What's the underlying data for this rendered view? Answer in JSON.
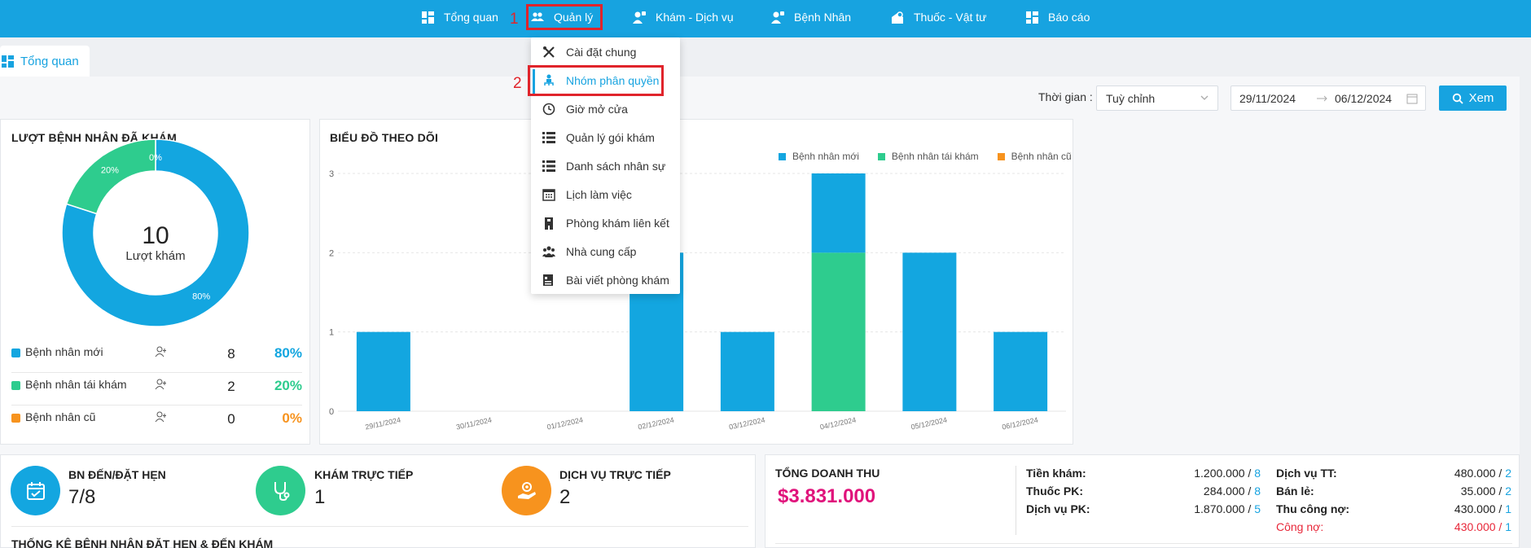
{
  "nav": {
    "items": [
      {
        "label": "Tổng quan",
        "icon": "dashboard-icon"
      },
      {
        "label": "Quản lý",
        "icon": "users-icon"
      },
      {
        "label": "Khám - Dịch vụ",
        "icon": "user-doctor-icon"
      },
      {
        "label": "Bệnh Nhân",
        "icon": "user-patient-icon"
      },
      {
        "label": "Thuốc - Vật tư",
        "icon": "pill-icon"
      },
      {
        "label": "Báo cáo",
        "icon": "report-icon"
      }
    ],
    "step1": "1",
    "step2": "2"
  },
  "tab": {
    "label": "Tổng quan"
  },
  "filter": {
    "label": "Thời gian :",
    "range_option": "Tuỳ chỉnh",
    "date_from": "29/11/2024",
    "date_to": "06/12/2024",
    "view_button": "Xem"
  },
  "menu": {
    "items": [
      {
        "label": "Cài đặt chung",
        "icon": "tools-icon"
      },
      {
        "label": "Nhóm phân quyền",
        "icon": "org-icon"
      },
      {
        "label": "Giờ mở cửa",
        "icon": "clock-icon"
      },
      {
        "label": "Quản lý gói khám",
        "icon": "list-icon"
      },
      {
        "label": "Danh sách nhân sự",
        "icon": "list-icon"
      },
      {
        "label": "Lịch làm việc",
        "icon": "calendar-icon"
      },
      {
        "label": "Phòng khám liên kết",
        "icon": "building-icon"
      },
      {
        "label": "Nhà cung cấp",
        "icon": "people-icon"
      },
      {
        "label": "Bài viết phòng khám",
        "icon": "document-icon"
      }
    ]
  },
  "patients_card": {
    "title": "LƯỢT BỆNH NHÂN ĐÃ KHÁM",
    "total": "10",
    "total_label": "Lượt khám",
    "rows": [
      {
        "name": "Bệnh nhân mới",
        "count": "8",
        "percent": "80%",
        "color": "#13a6e0"
      },
      {
        "name": "Bệnh nhân tái khám",
        "count": "2",
        "percent": "20%",
        "color": "#2ecc8e"
      },
      {
        "name": "Bệnh nhân cũ",
        "count": "0",
        "percent": "0%",
        "color": "#f7931e"
      }
    ]
  },
  "chart_data": [
    {
      "type": "pie",
      "labels": [
        "Bệnh nhân mới",
        "Bệnh nhân tái khám",
        "Bệnh nhân cũ"
      ],
      "values": [
        8,
        2,
        0
      ],
      "slice_labels": [
        "80%",
        "20%",
        "0%"
      ],
      "colors": [
        "#13a6e0",
        "#2ecc8e",
        "#f7931e"
      ]
    },
    {
      "type": "bar",
      "title": "BIỂU ĐỒ THEO DÕI",
      "stacked": true,
      "categories": [
        "29/11/2024",
        "30/11/2024",
        "01/12/2024",
        "02/12/2024",
        "03/12/2024",
        "04/12/2024",
        "05/12/2024",
        "06/12/2024"
      ],
      "series": [
        {
          "name": "Bệnh nhân cũ",
          "values": [
            0,
            0,
            0,
            0,
            0,
            0,
            0,
            0
          ],
          "color": "#f7931e"
        },
        {
          "name": "Bệnh nhân tái khám",
          "values": [
            0,
            0,
            0,
            0,
            0,
            2,
            0,
            0
          ],
          "color": "#2ecc8e"
        },
        {
          "name": "Bệnh nhân mới",
          "values": [
            1,
            0,
            0,
            2,
            1,
            1,
            2,
            1
          ],
          "color": "#13a6e0"
        }
      ],
      "legend_order": [
        "Bệnh nhân mới",
        "Bệnh nhân tái khám",
        "Bệnh nhân cũ"
      ],
      "yticks": [
        "0",
        "1",
        "2",
        "3"
      ],
      "ylim": [
        0,
        3
      ],
      "legend_position": "top-right",
      "grid": true
    }
  ],
  "stats": {
    "appointments": {
      "label": "BN ĐẾN/ĐẶT HẸN",
      "value": "7/8",
      "color": "#13a6e0"
    },
    "direct_exam": {
      "label": "KHÁM TRỰC TIẾP",
      "value": "1",
      "color": "#2ecc8e"
    },
    "direct_service": {
      "label": "DỊCH VỤ TRỰC TIẾP",
      "value": "2",
      "color": "#f7931e"
    },
    "section_title": "THỐNG KÊ BỆNH NHÂN ĐẶT HẸN & ĐẾN KHÁM"
  },
  "revenue": {
    "title": "TỔNG DOANH THU",
    "total": "$3.831.000",
    "left": [
      {
        "label": "Tiền khám:",
        "amount": "1.200.000",
        "count": "8"
      },
      {
        "label": "Thuốc PK:",
        "amount": "284.000",
        "count": "8"
      },
      {
        "label": "Dịch vụ PK:",
        "amount": "1.870.000",
        "count": "5"
      }
    ],
    "right": [
      {
        "label": "Dịch vụ TT:",
        "amount": "480.000",
        "count": "2"
      },
      {
        "label": "Bán lẻ:",
        "amount": "35.000",
        "count": "2"
      },
      {
        "label": "Thu công nợ:",
        "amount": "430.000",
        "count": "1"
      },
      {
        "label": "Công nợ:",
        "amount": "430.000",
        "count": "1"
      }
    ]
  }
}
